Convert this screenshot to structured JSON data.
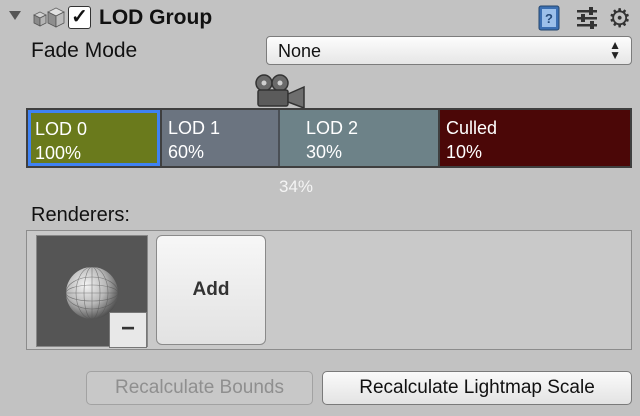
{
  "header": {
    "title": "LOD Group",
    "enabled": true,
    "checkmark": "✓",
    "icons": [
      "foldout-triangle-icon",
      "component-cubes-icon",
      "help-book-icon",
      "preset-sliders-icon",
      "gear-icon"
    ]
  },
  "fade_mode": {
    "label": "Fade Mode",
    "value": "None"
  },
  "lod_bar": {
    "segments": [
      {
        "name": "LOD 0",
        "percent": "100%",
        "color": "#6a7a1c",
        "selected": true
      },
      {
        "name": "LOD 1",
        "percent": "60%",
        "color": "#6b7480",
        "selected": false
      },
      {
        "name": "LOD 2",
        "percent": "30%",
        "color": "#6d8288",
        "selected": false
      },
      {
        "name": "Culled",
        "percent": "10%",
        "color": "#4b0707",
        "selected": false
      }
    ],
    "camera_percent": "34%",
    "selection_color": "#3f82f4"
  },
  "renderers": {
    "label": "Renderers:",
    "remove_label": "−",
    "add_label": "Add"
  },
  "buttons": {
    "recalculate_bounds": "Recalculate Bounds",
    "recalculate_lightmap_scale": "Recalculate Lightmap Scale"
  }
}
